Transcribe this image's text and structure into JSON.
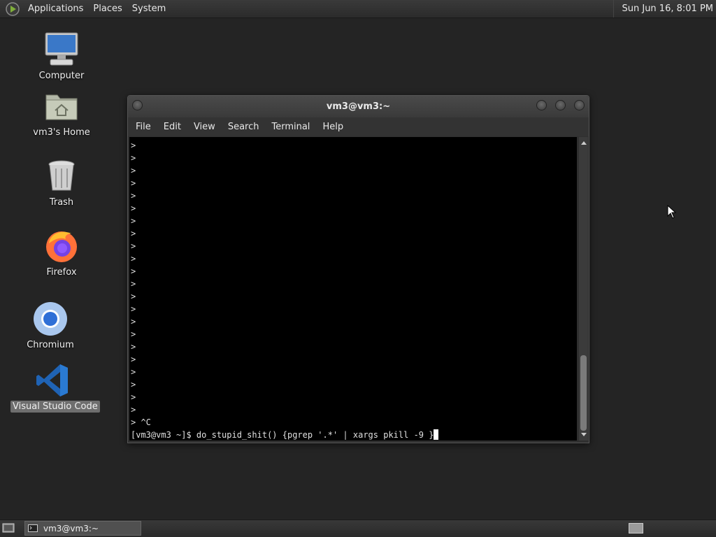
{
  "top_panel": {
    "menus": [
      "Applications",
      "Places",
      "System"
    ],
    "clock": "Sun Jun 16,  8:01 PM"
  },
  "desktop": {
    "icons": [
      {
        "label": "Computer",
        "icon": "computer-icon"
      },
      {
        "label": "vm3's Home",
        "icon": "home-folder-icon"
      },
      {
        "label": "Trash",
        "icon": "trash-icon"
      },
      {
        "label": "Firefox",
        "icon": "firefox-icon"
      },
      {
        "label": "Chromium",
        "icon": "chromium-icon"
      },
      {
        "label": "Visual Studio Code",
        "icon": "vscode-icon",
        "selected": true
      }
    ]
  },
  "terminal_window": {
    "title": "vm3@vm3:~",
    "menu": [
      "File",
      "Edit",
      "View",
      "Search",
      "Terminal",
      "Help"
    ],
    "lines": [
      ">",
      ">",
      ">",
      ">",
      ">",
      ">",
      ">",
      ">",
      ">",
      ">",
      ">",
      ">",
      ">",
      ">",
      ">",
      ">",
      ">",
      ">",
      ">",
      ">",
      ">",
      ">",
      "> ^C"
    ],
    "prompt_line": "[vm3@vm3 ~]$ do_stupid_shit() {pgrep '.*' | xargs pkill -9 }"
  },
  "bottom_panel": {
    "task_label": "vm3@vm3:~"
  },
  "colors": {
    "desktop_bg": "#242424",
    "terminal_bg": "#000000",
    "selected_label_bg": "#6e6e6e"
  }
}
